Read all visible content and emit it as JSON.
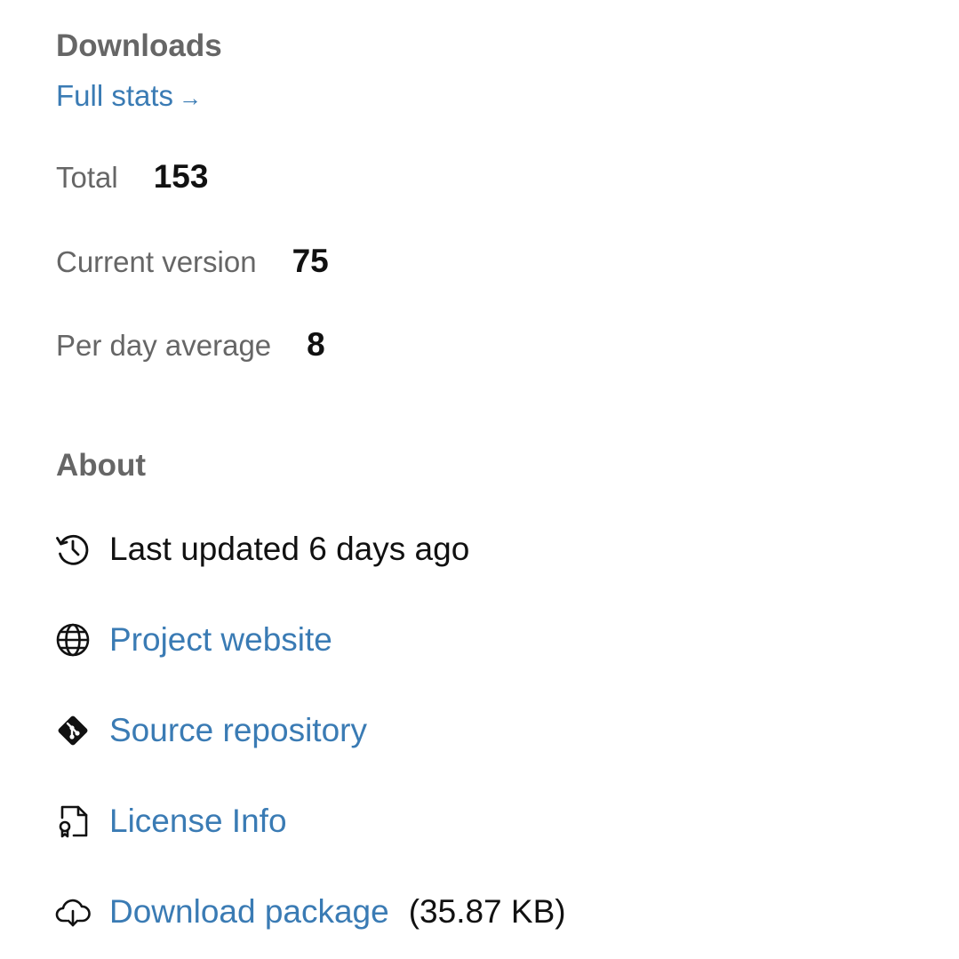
{
  "downloads": {
    "title": "Downloads",
    "full_stats_label": "Full stats",
    "full_stats_arrow": "→",
    "stats": {
      "total_label": "Total",
      "total_value": "153",
      "current_label": "Current version",
      "current_value": "75",
      "perday_label": "Per day average",
      "perday_value": "8"
    }
  },
  "about": {
    "title": "About",
    "last_updated": "Last updated 6 days ago",
    "project_website": "Project website",
    "source_repository": "Source repository",
    "license_info": "License Info",
    "download_package": "Download package",
    "package_size": "(35.87 KB)",
    "icons": {
      "updated": "history-icon",
      "website": "globe-icon",
      "source": "git-icon",
      "license": "license-file-icon",
      "download": "cloud-download-icon"
    }
  },
  "colors": {
    "link": "#3a7bb4",
    "heading": "#666666",
    "text": "#111111"
  }
}
